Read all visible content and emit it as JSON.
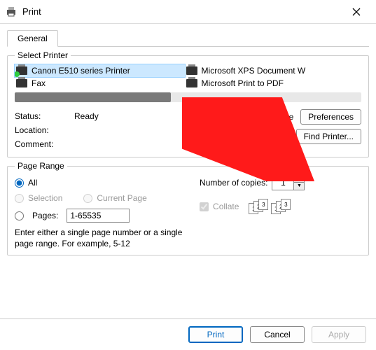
{
  "window": {
    "title": "Print"
  },
  "tabs": {
    "general": "General"
  },
  "select_printer": {
    "title": "Select Printer",
    "printers": [
      {
        "name": "Canon E510 series Printer",
        "selected": true
      },
      {
        "name": "Microsoft XPS Document W",
        "selected": false
      },
      {
        "name": "Fax",
        "selected": false
      },
      {
        "name": "Microsoft Print to PDF",
        "selected": false
      }
    ],
    "status_label": "Status:",
    "status_value": "Ready",
    "location_label": "Location:",
    "location_value": "",
    "comment_label": "Comment:",
    "comment_value": "",
    "print_to_file_label": "Print to file",
    "preferences_btn": "Preferences",
    "find_printer_btn": "Find Printer..."
  },
  "page_range": {
    "title": "Page Range",
    "all_label": "All",
    "selection_label": "Selection",
    "current_page_label": "Current Page",
    "pages_label": "Pages:",
    "pages_value": "1-65535",
    "hint": "Enter either a single page number or a single page range.  For example, 5-12",
    "copies_label": "Number of copies:",
    "copies_value": "1",
    "collate_label": "Collate",
    "mini_pages": [
      "1",
      "2",
      "3"
    ]
  },
  "footer": {
    "print": "Print",
    "cancel": "Cancel",
    "apply": "Apply"
  }
}
